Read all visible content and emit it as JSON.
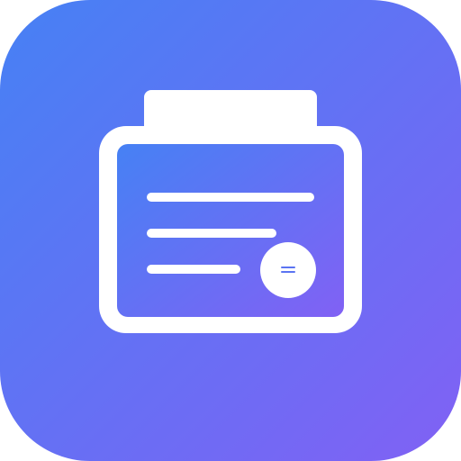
{
  "app_icon": {
    "gradient_start": "#4681f4",
    "gradient_end": "#8161f4",
    "glyph_color": "#ffffff",
    "badge_mark_color": "#5b74f2",
    "icon_name": "document-tray-icon",
    "badge_icon_name": "equals-badge-icon"
  }
}
